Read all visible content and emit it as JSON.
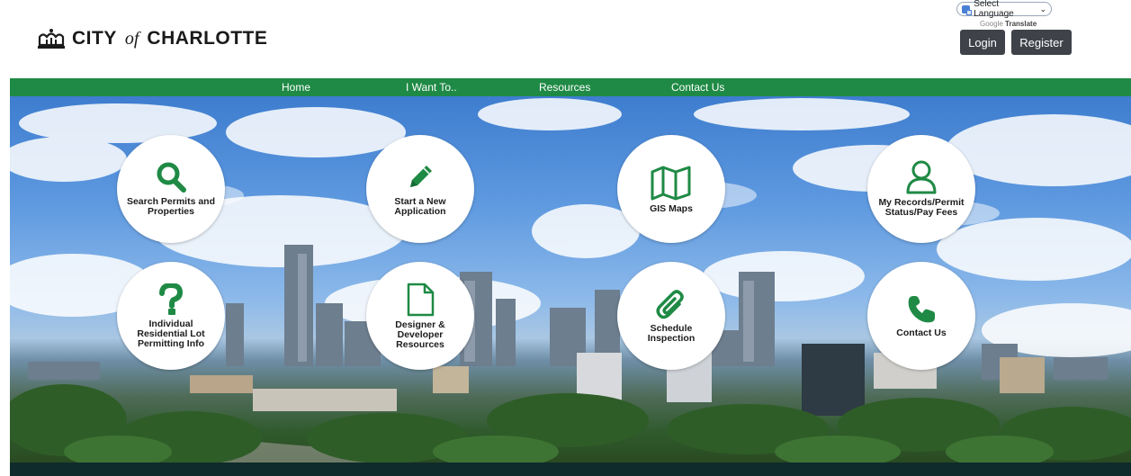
{
  "header": {
    "logo": {
      "part1": "CITY",
      "part2": "of",
      "part3": "CHARLOTTE"
    },
    "language": {
      "selected": "Select Language",
      "powered_prefix": "Google",
      "powered_suffix": "Translate"
    },
    "login_label": "Login",
    "register_label": "Register"
  },
  "nav": {
    "items": [
      {
        "label": "Home"
      },
      {
        "label": "I Want To.."
      },
      {
        "label": "Resources"
      },
      {
        "label": "Contact Us"
      }
    ]
  },
  "tiles": [
    {
      "label": "Search Permits and Properties",
      "icon": "search-icon"
    },
    {
      "label": "Start a New Application",
      "icon": "pencil-icon"
    },
    {
      "label": "GIS Maps",
      "icon": "map-icon"
    },
    {
      "label": "My Records/Permit Status/Pay Fees",
      "icon": "user-icon"
    },
    {
      "label": "Individual Residential Lot Permitting Info",
      "icon": "question-icon"
    },
    {
      "label": "Designer & Developer Resources",
      "icon": "document-icon"
    },
    {
      "label": "Schedule Inspection",
      "icon": "paperclip-icon"
    },
    {
      "label": "Contact Us",
      "icon": "phone-icon"
    }
  ],
  "colors": {
    "brand_green": "#1f8a45",
    "button_dark": "#3f4349",
    "footer": "#0f2b2b"
  }
}
